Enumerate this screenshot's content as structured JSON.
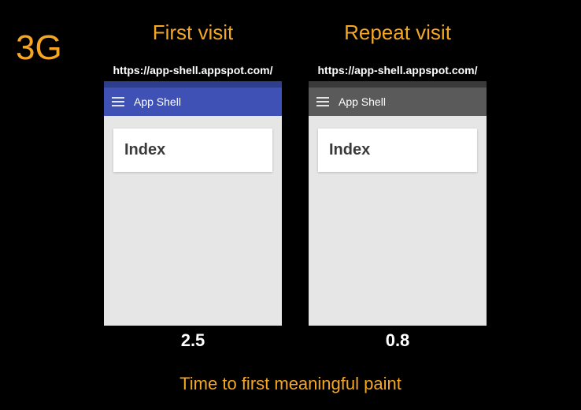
{
  "network_label": "3G",
  "footer_caption": "Time to first meaningful paint",
  "columns": {
    "first": {
      "heading": "First visit",
      "url": "https://app-shell.appspot.com/",
      "app_title": "App Shell",
      "card_title": "Index",
      "timing": "2.5"
    },
    "repeat": {
      "heading": "Repeat visit",
      "url": "https://app-shell.appspot.com/",
      "app_title": "App Shell",
      "card_title": "Index",
      "timing": "0.8"
    }
  }
}
